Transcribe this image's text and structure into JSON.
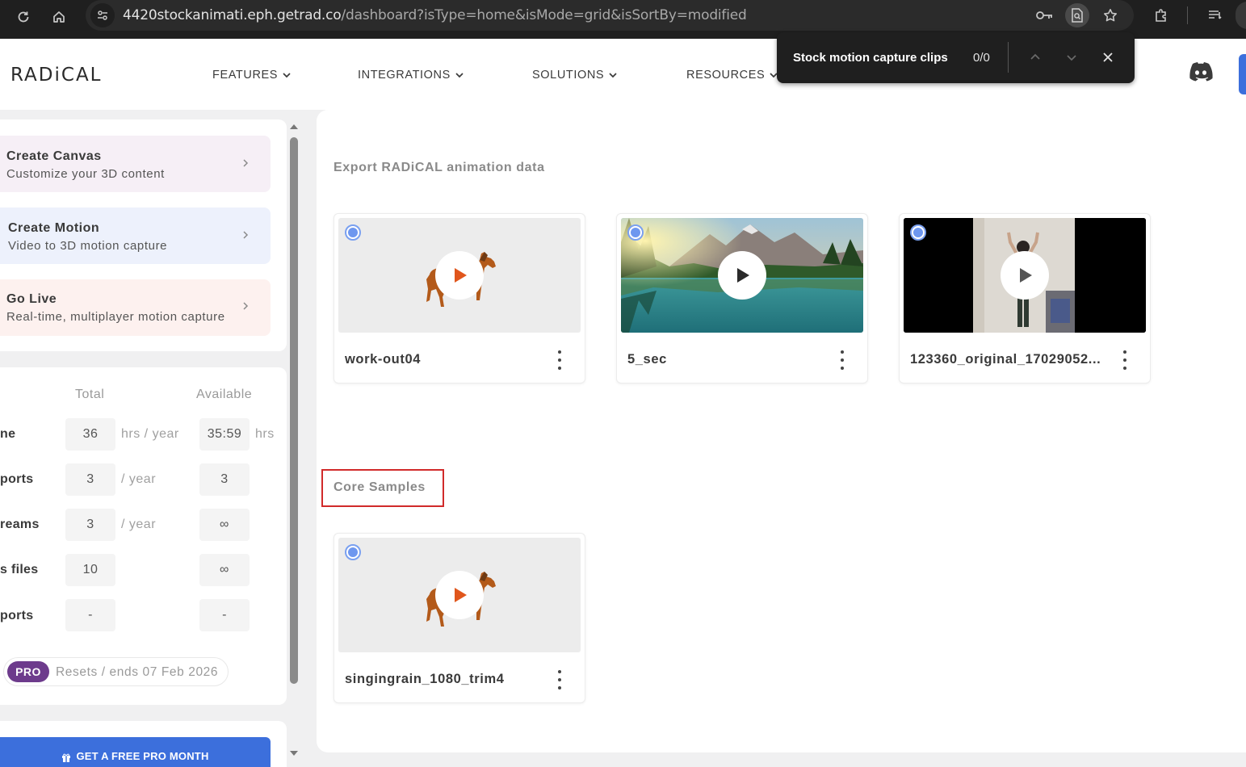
{
  "browser": {
    "url_host": "4420stockanimati.eph.getrad.co",
    "url_path": "/dashboard?isType=home&isMode=grid&isSortBy=modified"
  },
  "find_bar": {
    "query": "Stock motion capture clips",
    "count": "0/0"
  },
  "header": {
    "logo": "RADiCAL",
    "menu": [
      {
        "label": "FEATURES"
      },
      {
        "label": "INTEGRATIONS"
      },
      {
        "label": "SOLUTIONS"
      },
      {
        "label": "RESOURCES"
      }
    ]
  },
  "sidebar": {
    "actions": [
      {
        "title": "Create Canvas",
        "subtitle": "Customize your 3D content",
        "bg": "#f6eff6"
      },
      {
        "title": "Create Motion",
        "subtitle": "Video to 3D motion capture",
        "bg": "#edf1fc"
      },
      {
        "title": "Go Live",
        "subtitle": "Real-time, multiplayer motion capture",
        "bg": "#fdf1ef"
      }
    ],
    "usage": {
      "col_total": "Total",
      "col_available": "Available",
      "rows": [
        {
          "label": "ne",
          "total": "36",
          "total_unit": "hrs / year",
          "available": "35:59",
          "available_unit": "hrs"
        },
        {
          "label": "ports",
          "total": "3",
          "total_unit": "/ year",
          "available": "3",
          "available_unit": ""
        },
        {
          "label": "reams",
          "total": "3",
          "total_unit": "/ year",
          "available": "∞",
          "available_unit": ""
        },
        {
          "label": "s files",
          "total": "10",
          "total_unit": "",
          "available": "∞",
          "available_unit": ""
        },
        {
          "label": "ports",
          "total": "-",
          "total_unit": "",
          "available": "-",
          "available_unit": ""
        }
      ]
    },
    "plan": {
      "badge": "PRO",
      "text": "Resets / ends 07 Feb 2026"
    },
    "promo": {
      "label": "GET A FREE PRO MONTH"
    }
  },
  "main": {
    "sections": [
      {
        "title": "Export RADiCAL animation data",
        "clips": [
          {
            "name": "work-out04",
            "thumb": "horse-icon"
          },
          {
            "name": "5_sec",
            "thumb": "lake-mountain-photo"
          },
          {
            "name": "123360_original_17029052...",
            "thumb": "person-video-frame"
          }
        ]
      },
      {
        "title": "Core Samples",
        "clips": [
          {
            "name": "singingrain_1080_trim4",
            "thumb": "horse-icon"
          }
        ]
      }
    ]
  },
  "colors": {
    "accent_blue": "#3c6fdc",
    "play_orange": "#e0561c",
    "pro_purple": "#6d3b8c",
    "highlight_red": "#d12a2a"
  }
}
